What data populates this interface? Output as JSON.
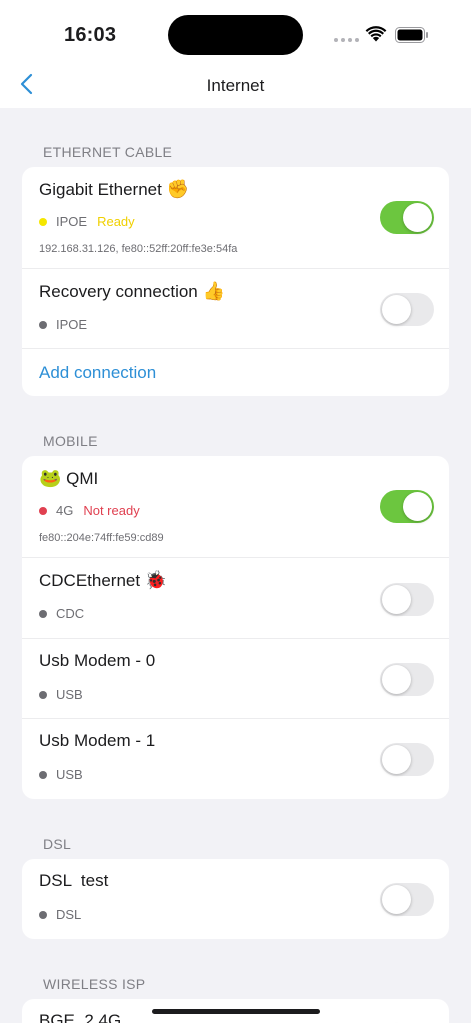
{
  "status_bar": {
    "time": "16:03"
  },
  "nav": {
    "title": "Internet"
  },
  "sections": {
    "ethernet": {
      "header": "ETHERNET CABLE",
      "rows": [
        {
          "title": "Gigabit Ethernet",
          "emoji": "✊",
          "proto": "IPOE",
          "state": "Ready",
          "dot_color": "#f5e700",
          "state_color": "#f0d000",
          "address": "192.168.31.126, fe80::52ff:20ff:fe3e:54fa",
          "enabled": true
        },
        {
          "title": "Recovery connection",
          "emoji": "👍",
          "proto": "IPOE",
          "state": "",
          "dot_color": "#6d6d72",
          "enabled": false
        }
      ],
      "add_label": "Add connection"
    },
    "mobile": {
      "header": "MOBILE",
      "rows": [
        {
          "title": "QMI",
          "emoji": "🐸",
          "proto": "4G",
          "state": "Not ready",
          "dot_color": "#e04050",
          "state_color": "#e04050",
          "address": "fe80::204e:74ff:fe59:cd89",
          "enabled": true
        },
        {
          "title": "CDCEthernet",
          "emoji": "🐞",
          "proto": "CDC",
          "enabled": false
        },
        {
          "title": "Usb Modem - 0",
          "proto": "USB",
          "enabled": false
        },
        {
          "title": "Usb Modem - 1",
          "proto": "USB",
          "enabled": false
        }
      ]
    },
    "dsl": {
      "header": "DSL",
      "rows": [
        {
          "title": "DSL  test",
          "proto": "DSL",
          "enabled": false
        }
      ]
    },
    "wireless": {
      "header": "WIRELESS ISP",
      "rows": [
        {
          "title": "BGE_2.4G"
        }
      ]
    }
  },
  "colors": {
    "accent": "#2d8fd6",
    "toggle_on": "#6cc63f",
    "background": "#f2f2f6"
  }
}
